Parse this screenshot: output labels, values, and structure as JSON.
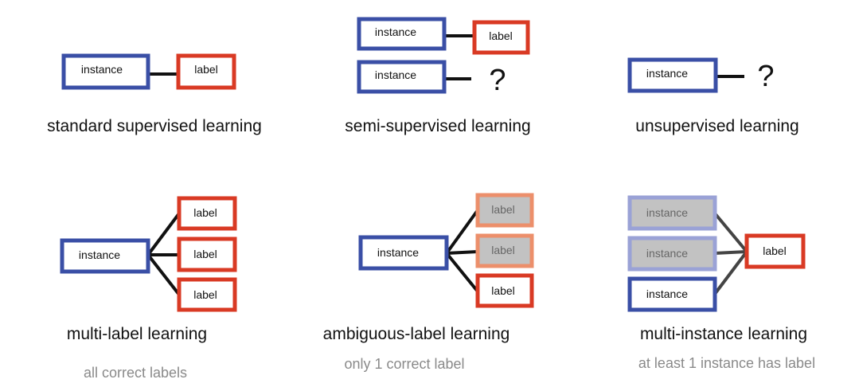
{
  "colors": {
    "instance_border": "#3a4fa6",
    "label_border": "#d93a24",
    "faded_instance_border": "#9aa2d6",
    "faded_label_border": "#ec8f6b",
    "faded_fill": "#c2c2c2",
    "faded_text": "#666666",
    "connector": "#111111",
    "subtitle": "#8a8a8a"
  },
  "panels": {
    "standard": {
      "title": "standard supervised learning",
      "instance": "instance",
      "label": "label"
    },
    "semi": {
      "title": "semi-supervised learning",
      "instance_1": "instance",
      "label_1": "label",
      "instance_2": "instance",
      "unknown": "?"
    },
    "unsupervised": {
      "title": "unsupervised learning",
      "instance": "instance",
      "unknown": "?"
    },
    "multi_label": {
      "title": "multi-label learning",
      "subtitle": "all correct labels",
      "instance": "instance",
      "labels": [
        "label",
        "label",
        "label"
      ]
    },
    "ambiguous": {
      "title": "ambiguous-label learning",
      "subtitle": "only 1 correct label",
      "instance": "instance",
      "labels": [
        "label",
        "label",
        "label"
      ]
    },
    "multi_instance": {
      "title": "multi-instance learning",
      "subtitle": "at least 1 instance has label",
      "instances": [
        "instance",
        "instance",
        "instance"
      ],
      "label": "label"
    }
  }
}
